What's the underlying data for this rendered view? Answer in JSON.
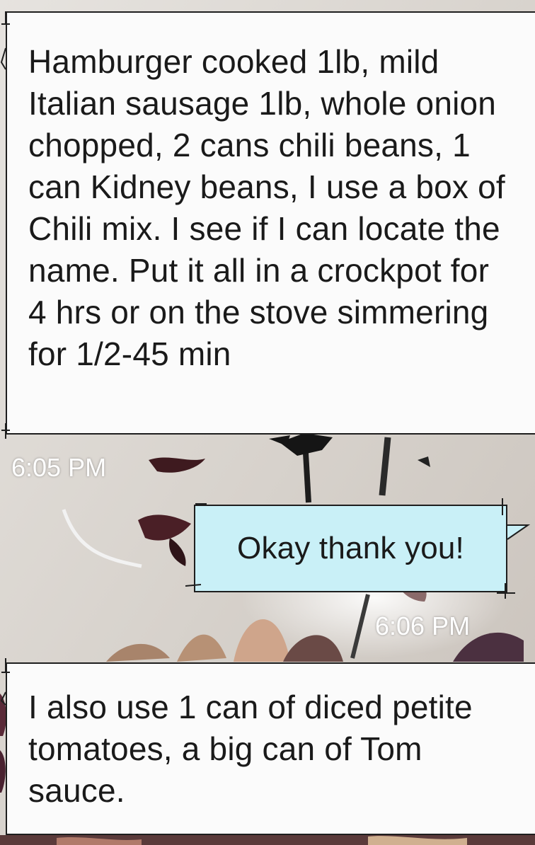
{
  "thread": {
    "messages": [
      {
        "direction": "incoming",
        "text": "Hamburger cooked 1lb, mild Italian sausage 1lb, whole onion chopped, 2 cans chili beans, 1 can Kidney beans, I use a box of Chili mix. I see if I can locate the name. Put it all in a crockpot for 4 hrs or on the stove simmering for 1/2-45 min",
        "time": "6:05 PM"
      },
      {
        "direction": "outgoing",
        "text": "Okay thank you!",
        "time": "6:06 PM"
      },
      {
        "direction": "incoming",
        "text": "I also use 1 can of diced petite tomatoes, a big can of Tom sauce."
      }
    ]
  },
  "colors": {
    "incoming_bubble": "#fbfbfb",
    "outgoing_bubble": "#c9f0f7",
    "bubble_border": "#1e1e1e",
    "timestamp": "#ffffff"
  },
  "wallpaper": {
    "description_icon": "flower-wallpaper"
  }
}
